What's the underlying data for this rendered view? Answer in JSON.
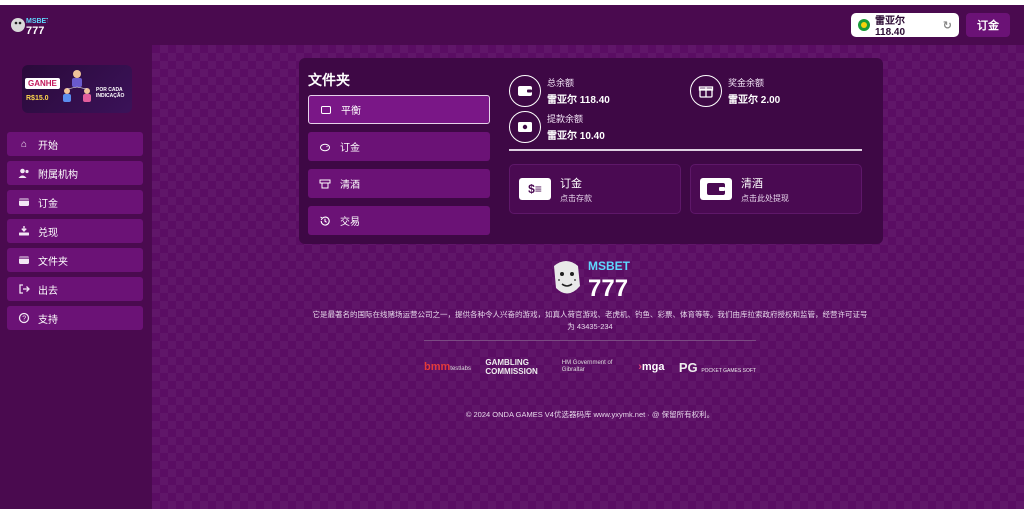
{
  "header": {
    "logo_text": "MSBET 777",
    "balance_pill": "雷亚尔 118.40",
    "deposit_button": "订金"
  },
  "sidebar": {
    "promo": {
      "title": "GANHE",
      "amount": "R$15.0",
      "caption": "POR CADA INDICAÇÃO"
    },
    "items": [
      {
        "label": "开始",
        "icon": "home-icon"
      },
      {
        "label": "附属机构",
        "icon": "users-icon"
      },
      {
        "label": "订金",
        "icon": "wallet-icon"
      },
      {
        "label": "兑现",
        "icon": "withdraw-icon"
      },
      {
        "label": "文件夹",
        "icon": "folder-icon"
      },
      {
        "label": "出去",
        "icon": "logout-icon"
      },
      {
        "label": "支持",
        "icon": "support-icon"
      }
    ]
  },
  "wallet": {
    "title": "文件夹",
    "tabs": [
      {
        "label": "平衡",
        "icon": "balance-icon",
        "active": true
      },
      {
        "label": "订金",
        "icon": "piggy-icon",
        "active": false
      },
      {
        "label": "清酒",
        "icon": "cashout-icon",
        "active": false
      },
      {
        "label": "交易",
        "icon": "history-icon",
        "active": false
      }
    ],
    "balances": {
      "total": {
        "label": "总余额",
        "value": "雷亚尔 118.40"
      },
      "bonus": {
        "label": "奖金余额",
        "value": "雷亚尔 2.00"
      },
      "withdrawable": {
        "label": "提款余额",
        "value": "雷亚尔 10.40"
      }
    },
    "actions": [
      {
        "title": "订金",
        "subtitle": "点击存款",
        "icon": "cash-icon"
      },
      {
        "title": "清酒",
        "subtitle": "点击此处提现",
        "icon": "wallet-icon"
      }
    ]
  },
  "footer": {
    "brand_text": "MSBET 777",
    "description": "它是最著名的国际在线赌场运营公司之一，提供各种令人兴奋的游戏，如真人荷官游戏、老虎机、钓鱼、彩票、体育等等。我们由库拉索政府授权和监管，经营许可证号为 43435-234",
    "partners": {
      "bmm": "bmm",
      "bmm_sub": "testlabs",
      "gambling_commission": "GAMBLING COMMISSION",
      "hm_gov": "HM Government of Gibraltar",
      "mga": "mga",
      "mga_prefix": "›",
      "pg": "PG",
      "pg_sub": "POCKET GAMES SOFT"
    },
    "copyright": "© 2024 ONDA GAMES V4优选器码库 www.yxymk.net · @ 保留所有权利。"
  },
  "colors": {
    "background": "#4a0a4f",
    "main_bg": "#5a0d63",
    "panel": "#3e0845",
    "button": "#6b1276"
  }
}
